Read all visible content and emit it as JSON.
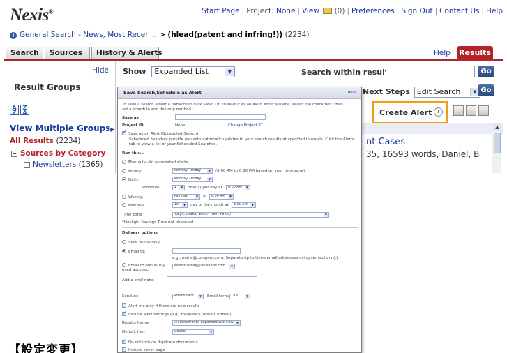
{
  "brand": {
    "logo": "Nexis",
    "logo_mark": "®"
  },
  "topnav": {
    "start_page": "Start Page",
    "project_label": "Project:",
    "project_value": "None",
    "view_label": "View",
    "view_count": "(0)",
    "preferences": "Preferences",
    "sign_out": "Sign Out",
    "contact_us": "Contact Us",
    "help": "Help"
  },
  "breadcrumb": {
    "link": "General Search - News, Most Recen...",
    "sep": ">",
    "query": "(hlead(patent and infring!))",
    "count": "(2234)"
  },
  "tabs": {
    "search": "Search",
    "sources": "Sources",
    "history": "History & Alerts",
    "help": "Help",
    "results": "Results"
  },
  "left": {
    "hide": "Hide",
    "result_groups": "Result Groups",
    "view_multiple": "View Multiple Groups",
    "all_results": "All Results",
    "all_results_count": "(2234)",
    "sources_by_category": "Sources by Category",
    "newsletters": "Newsletters",
    "newsletters_count": "(1365)"
  },
  "toolbar": {
    "show_label": "Show",
    "show_value": "Expanded List",
    "search_within": "Search within results",
    "go": "Go",
    "next_steps": "Next Steps",
    "next_steps_value": "Edit Search",
    "create_alert": "Create Alert"
  },
  "results": {
    "item1": "nt Cases",
    "item2": "35, 16593 words, Daniel, B"
  },
  "dialog": {
    "title": "Save Search/Schedule as Alert",
    "help": "Help",
    "intro1": "To save a search, enter a name then click Save. Or, to save it as an alert, enter a name, select the check box, then",
    "intro2": "set a schedule and delivery method.",
    "save_as": "Save as",
    "project_id_label": "Project ID",
    "project_id_value": "None",
    "change_project": "Change Project ID...",
    "save_as_alert": "Save as an Alert (Scheduled Search)",
    "sched_note1": "Scheduled Searches provide you with automatic updates to your search results at specified intervals. Click the Alerts",
    "sched_note2": "tab to view a list of your Scheduled Searches.",
    "run_this": "Run this...",
    "manually": "Manually--No automated alerts",
    "hourly": "Hourly:",
    "hourly_days": "Monday - Friday",
    "hourly_note": "(6:00 AM to 6:00 PM based on your time zone)",
    "daily": "Daily:",
    "daily_days": "Monday - Friday",
    "schedule": "Schedule",
    "times_per_day_count": "1",
    "times_per_day": "time(s) per day at",
    "daily_time": "8:00 AM",
    "weekly": "Weekly:",
    "weekly_day": "Monday",
    "at": "at",
    "weekly_time": "8:00 AM",
    "monthly": "Monthly:",
    "monthly_day": "1st",
    "day_of_month": "day of the month at",
    "monthly_time": "8:00 AM",
    "time_zone": "Time zone",
    "time_zone_value": "Tokyo, Osaka, Seoul* (GMT+9:00)",
    "dst_note": "*Daylight Savings Time not observed",
    "delivery": "Delivery options",
    "view_online": "View online only",
    "email_to": "Email to:",
    "email_hint": "e.g., name@company.com. Separate up to three email addresses using semicolons (;).",
    "email_prev": "Email to previously used address:",
    "email_prev_value": "kazuko.usnag@lexisnexis.com",
    "brief_note": "Add a brief note:",
    "send_as": "Send as:",
    "send_as_value": "Attachment",
    "email_format": "Email format",
    "email_format_value": "DOC",
    "alert_only": "Alert me only if there are new results",
    "include_settings": "Include alert settings (e.g., frequency, results format)",
    "results_format": "Results format",
    "results_format_value": "All Documents, Expanded List View",
    "default_font": "Default font",
    "default_font_value": "Courier",
    "no_duplicates": "Do not include duplicate documents",
    "cover_page": "Include cover page"
  },
  "caption": "【設定変更】"
}
